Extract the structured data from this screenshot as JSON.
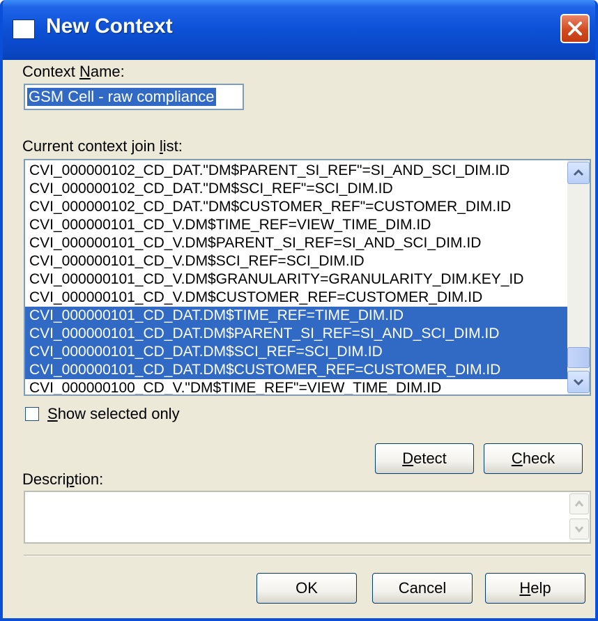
{
  "dialog": {
    "title": "New Context",
    "context_name_label_pre": "Context ",
    "context_name_label_key": "N",
    "context_name_label_post": "ame:",
    "context_name_value": "GSM Cell - raw compliance",
    "join_list_label_pre": "Current context join ",
    "join_list_label_key": "l",
    "join_list_label_post": "ist:",
    "join_list_items": [
      {
        "text": "CVI_000000102_CD_DAT.\"DM$PARENT_SI_REF\"=SI_AND_SCI_DIM.ID",
        "selected": false
      },
      {
        "text": "CVI_000000102_CD_DAT.\"DM$SCI_REF\"=SCI_DIM.ID",
        "selected": false
      },
      {
        "text": "CVI_000000102_CD_DAT.\"DM$CUSTOMER_REF\"=CUSTOMER_DIM.ID",
        "selected": false
      },
      {
        "text": "CVI_000000101_CD_V.DM$TIME_REF=VIEW_TIME_DIM.ID",
        "selected": false
      },
      {
        "text": "CVI_000000101_CD_V.DM$PARENT_SI_REF=SI_AND_SCI_DIM.ID",
        "selected": false
      },
      {
        "text": "CVI_000000101_CD_V.DM$SCI_REF=SCI_DIM.ID",
        "selected": false
      },
      {
        "text": "CVI_000000101_CD_V.DM$GRANULARITY=GRANULARITY_DIM.KEY_ID",
        "selected": false
      },
      {
        "text": "CVI_000000101_CD_V.DM$CUSTOMER_REF=CUSTOMER_DIM.ID",
        "selected": false
      },
      {
        "text": "CVI_000000101_CD_DAT.DM$TIME_REF=TIME_DIM.ID",
        "selected": true
      },
      {
        "text": "CVI_000000101_CD_DAT.DM$PARENT_SI_REF=SI_AND_SCI_DIM.ID",
        "selected": true
      },
      {
        "text": "CVI_000000101_CD_DAT.DM$SCI_REF=SCI_DIM.ID",
        "selected": true
      },
      {
        "text": "CVI_000000101_CD_DAT.DM$CUSTOMER_REF=CUSTOMER_DIM.ID",
        "selected": true
      },
      {
        "text": "CVI_000000100_CD_V.\"DM$TIME_REF\"=VIEW_TIME_DIM.ID",
        "selected": false
      }
    ],
    "show_selected_key": "S",
    "show_selected_post": "how selected only",
    "show_selected_checked": false,
    "detect_key": "D",
    "detect_post": "etect",
    "check_key": "C",
    "check_post": "heck",
    "description_label_pre": "Descri",
    "description_label_key": "p",
    "description_label_post": "tion:",
    "description_value": "",
    "ok_label": "OK",
    "cancel_label": "Cancel",
    "help_key": "H",
    "help_post": "elp"
  },
  "colors": {
    "title_bar": "#0a48c8",
    "selection": "#316ac5",
    "dialog_bg": "#ece9d8",
    "close_button": "#d24a21"
  },
  "icons": [
    "window-icon",
    "close-icon",
    "scroll-up-arrow-icon",
    "scroll-down-arrow-icon"
  ]
}
